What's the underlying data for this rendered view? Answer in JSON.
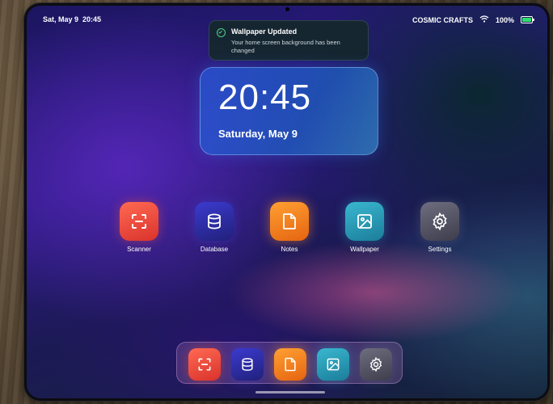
{
  "status_bar": {
    "date": "Sat, May 9",
    "time": "20:45",
    "carrier": "COSMIC CRAFTS",
    "battery": "100%",
    "battery_level": 1.0
  },
  "notification": {
    "title": "Wallpaper Updated",
    "body": "Your home screen background has been changed",
    "icon": "check-circle-icon"
  },
  "clock_widget": {
    "time": "20:45",
    "date": "Saturday, May 9"
  },
  "apps": [
    {
      "label": "Scanner",
      "icon": "scan-icon"
    },
    {
      "label": "Database",
      "icon": "database-icon"
    },
    {
      "label": "Notes",
      "icon": "note-icon"
    },
    {
      "label": "Wallpaper",
      "icon": "image-icon"
    },
    {
      "label": "Settings",
      "icon": "gear-icon"
    }
  ],
  "dock": {
    "apps": [
      "scan-icon",
      "database-icon",
      "note-icon",
      "image-icon",
      "gear-icon"
    ]
  },
  "colors": {
    "scanner": "#e8443a",
    "database": "#2c2ca8",
    "notes": "#f58522",
    "wallpaper": "#2a9fbb",
    "settings": "#555566",
    "battery": "#2ee06a",
    "notification_check": "#4fd08a"
  }
}
